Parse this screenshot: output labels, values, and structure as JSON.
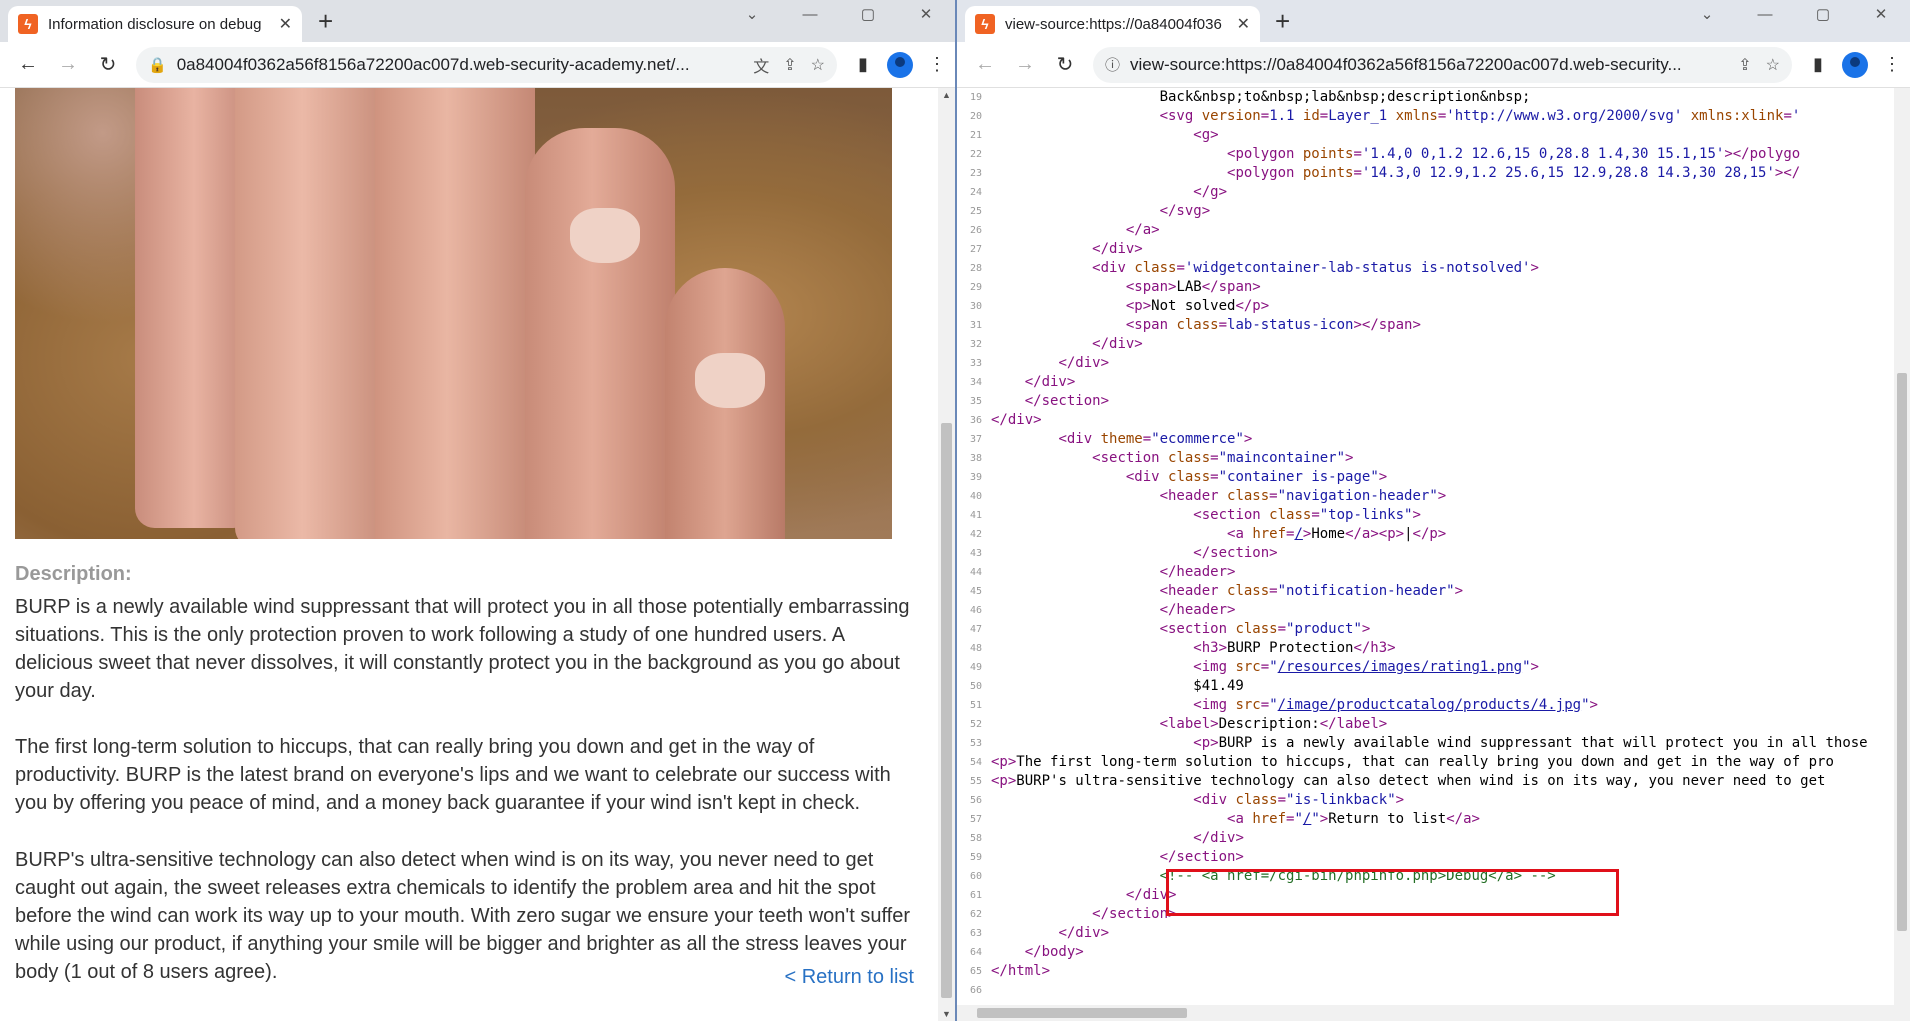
{
  "left_window": {
    "tab_title": "Information disclosure on debug",
    "url": "0a84004f0362a56f8156a72200ac007d.web-security-academy.net/...",
    "description_label": "Description:",
    "paragraphs": [
      "BURP is a newly available wind suppressant that will protect you in all those potentially embarrassing situations. This is the only protection proven to work following a study of one hundred users. A delicious sweet that never dissolves, it will constantly protect you in the background as you go about your day.",
      "The first long-term solution to hiccups, that can really bring you down and get in the way of productivity. BURP is the latest brand on everyone's lips and we want to celebrate our success with you by offering you peace of mind, and a money back guarantee if your wind isn't kept in check.",
      "BURP's ultra-sensitive technology can also detect when wind is on its way, you never need to get caught out again, the sweet releases extra chemicals to identify the problem area and hit the spot before the wind can work its way up to your mouth. With zero sugar we ensure your teeth won't suffer while using our product, if anything your smile will be bigger and brighter as all the stress leaves your body (1 out of 8 users agree)."
    ],
    "return_link": "< Return to list"
  },
  "right_window": {
    "tab_title": "view-source:https://0a84004f036",
    "url": "view-source:https://0a84004f0362a56f8156a72200ac007d.web-security...",
    "source_lines": [
      {
        "n": "19",
        "code": "                    Back&amp;nbsp;to&amp;nbsp;lab&amp;nbsp;description&amp;nbsp;"
      },
      {
        "n": "20",
        "code": "                    <span class=\"tag\">&lt;svg </span><span class=\"attr\">version</span><span class=\"tag\">=</span><span class=\"val\">1.1</span> <span class=\"attr\">id</span><span class=\"tag\">=</span><span class=\"val\">Layer_1</span> <span class=\"attr\">xmlns</span><span class=\"tag\">=</span><span class=\"val\">'http://www.w3.org/2000/svg'</span> <span class=\"attr\">xmlns:xlink</span><span class=\"tag\">=</span><span class=\"val\">'</span>"
      },
      {
        "n": "21",
        "code": "                        <span class=\"tag\">&lt;g&gt;</span>"
      },
      {
        "n": "22",
        "code": "                            <span class=\"tag\">&lt;polygon </span><span class=\"attr\">points</span><span class=\"tag\">=</span><span class=\"val\">'1.4,0 0,1.2 12.6,15 0,28.8 1.4,30 15.1,15'</span><span class=\"tag\">&gt;&lt;/polygo</span>"
      },
      {
        "n": "23",
        "code": "                            <span class=\"tag\">&lt;polygon </span><span class=\"attr\">points</span><span class=\"tag\">=</span><span class=\"val\">'14.3,0 12.9,1.2 25.6,15 12.9,28.8 14.3,30 28,15'</span><span class=\"tag\">&gt;&lt;/</span>"
      },
      {
        "n": "24",
        "code": "                        <span class=\"tag\">&lt;/g&gt;</span>"
      },
      {
        "n": "25",
        "code": "                    <span class=\"tag\">&lt;/svg&gt;</span>"
      },
      {
        "n": "26",
        "code": "                <span class=\"tag\">&lt;/a&gt;</span>"
      },
      {
        "n": "27",
        "code": "            <span class=\"tag\">&lt;/div&gt;</span>"
      },
      {
        "n": "28",
        "code": "            <span class=\"tag\">&lt;div </span><span class=\"attr\">class</span><span class=\"tag\">=</span><span class=\"val\">'widgetcontainer-lab-status is-notsolved'</span><span class=\"tag\">&gt;</span>"
      },
      {
        "n": "29",
        "code": "                <span class=\"tag\">&lt;span&gt;</span>LAB<span class=\"tag\">&lt;/span&gt;</span>"
      },
      {
        "n": "30",
        "code": "                <span class=\"tag\">&lt;p&gt;</span>Not solved<span class=\"tag\">&lt;/p&gt;</span>"
      },
      {
        "n": "31",
        "code": "                <span class=\"tag\">&lt;span </span><span class=\"attr\">class</span><span class=\"tag\">=</span><span class=\"val\">lab-status-icon</span><span class=\"tag\">&gt;&lt;/span&gt;</span>"
      },
      {
        "n": "32",
        "code": "            <span class=\"tag\">&lt;/div&gt;</span>"
      },
      {
        "n": "33",
        "code": "        <span class=\"tag\">&lt;/div&gt;</span>"
      },
      {
        "n": "34",
        "code": "    <span class=\"tag\">&lt;/div&gt;</span>"
      },
      {
        "n": "35",
        "code": "<span class=\"tag\">    &lt;/section&gt;</span>"
      },
      {
        "n": "36",
        "code": "<span class=\"tag\">&lt;/div&gt;</span>"
      },
      {
        "n": "37",
        "code": "        <span class=\"tag\">&lt;div </span><span class=\"attr\">theme</span><span class=\"tag\">=</span><span class=\"val\">\"ecommerce\"</span><span class=\"tag\">&gt;</span>"
      },
      {
        "n": "38",
        "code": "            <span class=\"tag\">&lt;section </span><span class=\"attr\">class</span><span class=\"tag\">=</span><span class=\"val\">\"maincontainer\"</span><span class=\"tag\">&gt;</span>"
      },
      {
        "n": "39",
        "code": "                <span class=\"tag\">&lt;div </span><span class=\"attr\">class</span><span class=\"tag\">=</span><span class=\"val\">\"container is-page\"</span><span class=\"tag\">&gt;</span>"
      },
      {
        "n": "40",
        "code": "                    <span class=\"tag\">&lt;header </span><span class=\"attr\">class</span><span class=\"tag\">=</span><span class=\"val\">\"navigation-header\"</span><span class=\"tag\">&gt;</span>"
      },
      {
        "n": "41",
        "code": "                        <span class=\"tag\">&lt;section </span><span class=\"attr\">class</span><span class=\"tag\">=</span><span class=\"val\">\"top-links\"</span><span class=\"tag\">&gt;</span>"
      },
      {
        "n": "42",
        "code": "                            <span class=\"tag\">&lt;a </span><span class=\"attr\">href</span><span class=\"tag\">=</span><span class=\"lnk\">/</span><span class=\"tag\">&gt;</span>Home<span class=\"tag\">&lt;/a&gt;&lt;p&gt;</span>|<span class=\"tag\">&lt;/p&gt;</span>"
      },
      {
        "n": "43",
        "code": "                        <span class=\"tag\">&lt;/section&gt;</span>"
      },
      {
        "n": "44",
        "code": "                    <span class=\"tag\">&lt;/header&gt;</span>"
      },
      {
        "n": "45",
        "code": "                    <span class=\"tag\">&lt;header </span><span class=\"attr\">class</span><span class=\"tag\">=</span><span class=\"val\">\"notification-header\"</span><span class=\"tag\">&gt;</span>"
      },
      {
        "n": "46",
        "code": "                    <span class=\"tag\">&lt;/header&gt;</span>"
      },
      {
        "n": "47",
        "code": "                    <span class=\"tag\">&lt;section </span><span class=\"attr\">class</span><span class=\"tag\">=</span><span class=\"val\">\"product\"</span><span class=\"tag\">&gt;</span>"
      },
      {
        "n": "48",
        "code": "                        <span class=\"tag\">&lt;h3&gt;</span>BURP Protection<span class=\"tag\">&lt;/h3&gt;</span>"
      },
      {
        "n": "49",
        "code": "                        <span class=\"tag\">&lt;img </span><span class=\"attr\">src</span><span class=\"tag\">=</span><span class=\"val\">\"</span><span class=\"lnk\">/resources/images/rating1.png</span><span class=\"val\">\"</span><span class=\"tag\">&gt;</span>"
      },
      {
        "n": "50",
        "code": "                        $41.49"
      },
      {
        "n": "51",
        "code": "                        <span class=\"tag\">&lt;img </span><span class=\"attr\">src</span><span class=\"tag\">=</span><span class=\"val\">\"</span><span class=\"lnk\">/image/productcatalog/products/4.jpg</span><span class=\"val\">\"</span><span class=\"tag\">&gt;</span>"
      },
      {
        "n": "52",
        "code": "                    <span class=\"tag\">&lt;label&gt;</span>Description:<span class=\"tag\">&lt;/label&gt;</span>"
      },
      {
        "n": "53",
        "code": "                        <span class=\"tag\">&lt;p&gt;</span>BURP is a newly available wind suppressant that will protect you in all those"
      },
      {
        "n": "54",
        "code": "<span class=\"tag\">&lt;p&gt;</span>The first long-term solution to hiccups, that can really bring you down and get in the way of pro"
      },
      {
        "n": "55",
        "code": "<span class=\"tag\">&lt;p&gt;</span>BURP's ultra-sensitive technology can also detect when wind is on its way, you never need to get"
      },
      {
        "n": "56",
        "code": "                        <span class=\"tag\">&lt;div </span><span class=\"attr\">class</span><span class=\"tag\">=</span><span class=\"val\">\"is-linkback\"</span><span class=\"tag\">&gt;</span>"
      },
      {
        "n": "57",
        "code": "                            <span class=\"tag\">&lt;a </span><span class=\"attr\">href</span><span class=\"tag\">=</span><span class=\"val\">\"</span><span class=\"lnk\">/</span><span class=\"val\">\"</span><span class=\"tag\">&gt;</span>Return to list<span class=\"tag\">&lt;/a&gt;</span>"
      },
      {
        "n": "58",
        "code": "                        <span class=\"tag\">&lt;/div&gt;</span>"
      },
      {
        "n": "59",
        "code": "                    <span class=\"tag\">&lt;/section&gt;</span>"
      },
      {
        "n": "60",
        "code": "                    <span class=\"cmt\">&lt;!-- &lt;a href=/cgi-bin/phpinfo.php&gt;Debug&lt;/a&gt; --&gt;</span>"
      },
      {
        "n": "61",
        "code": "                <span class=\"tag\">&lt;/div&gt;</span>"
      },
      {
        "n": "62",
        "code": "            <span class=\"tag\">&lt;/section&gt;</span>"
      },
      {
        "n": "63",
        "code": "        <span class=\"tag\">&lt;/div&gt;</span>"
      },
      {
        "n": "64",
        "code": "    <span class=\"tag\">&lt;/body&gt;</span>"
      },
      {
        "n": "65",
        "code": "<span class=\"tag\">&lt;/html&gt;</span>"
      },
      {
        "n": "66",
        "code": ""
      }
    ]
  },
  "icons": {
    "back": "←",
    "forward": "→",
    "reload": "↻",
    "lock": "🔒",
    "info": "ⓘ",
    "translate": "文",
    "share": "⇪",
    "star": "☆",
    "sidepanel": "▮",
    "menu": "⋮",
    "close": "✕",
    "newtab": "+",
    "minimize": "—",
    "maximize": "▢",
    "dropdown": "⌄"
  },
  "colors": {
    "highlight_box": "#e0101a",
    "comment": "#236e25",
    "tag": "#881280",
    "attribute": "#994500",
    "value": "#1a1aa6",
    "link": "#2871c4"
  }
}
